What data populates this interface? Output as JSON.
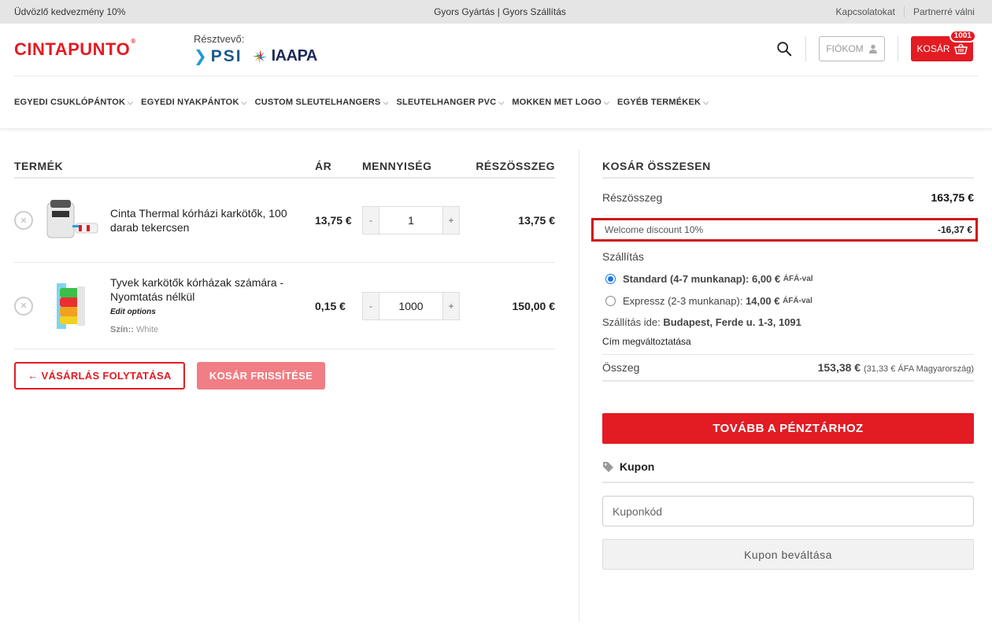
{
  "topbar": {
    "left": "Üdvözlő kedvezmény 10%",
    "center": "Gyors Gyártás | Gyors Szállítás",
    "links": [
      "Kapcsolatokat",
      "Partnerré válni"
    ]
  },
  "header": {
    "logo": "CINTAPUNTO",
    "logo_mark": "®",
    "partners_label": "Résztvevő:",
    "partner_psi": "PSI",
    "partner_iaapa": "IAAPA",
    "account_label": "FIÓKOM",
    "cart_label": "KOSÁR",
    "cart_count": "1001",
    "accent_color": "#e31b23"
  },
  "nav": [
    "EGYEDI CSUKLÓPÁNTOK",
    "EGYEDI NYAKPÁNTOK",
    "CUSTOM SLEUTELHANGERS",
    "SLEUTELHANGER PVC",
    "MOKKEN MET LOGO",
    "EGYÉB TERMÉKEK"
  ],
  "cart": {
    "headers": {
      "product": "TERMÉK",
      "price": "ÁR",
      "qty": "MENNYISÉG",
      "subtotal": "RÉSZÖSSZEG"
    },
    "items": [
      {
        "name": "Cinta Thermal kórházi karkötők, 100 darab tekercsen",
        "price": "13,75 €",
        "qty": "1",
        "subtotal": "13,75 €",
        "icon": "thermal-printer-icon"
      },
      {
        "name": "Tyvek karkötők kórházak számára - Nyomtatás nélkül",
        "edit": "Edit options",
        "color_label": "Szín:",
        "color_value": "White",
        "price": "0,15 €",
        "qty": "1000",
        "subtotal": "150,00 €",
        "icon": "wristband-rolls-icon"
      }
    ],
    "continue_label": "← VÁSÁRLÁS FOLYTATÁSA",
    "update_label": "KOSÁR FRISSÍTÉSE"
  },
  "totals": {
    "title": "KOSÁR ÖSSZESEN",
    "subtotal_label": "Részösszeg",
    "subtotal_value": "163,75 €",
    "discount_label": "Welcome discount 10%",
    "discount_value": "-16,37 €",
    "shipping_label": "Szállítás",
    "option_standard": "Standard (4-7 munkanap):",
    "option_standard_price": "6,00 €",
    "option_express": "Expressz (2-3 munkanap):",
    "option_express_price": "14,00 €",
    "vat_note": "ÁFÁ-val",
    "ship_to_label": "Szállítás ide:",
    "ship_to_value": "Budapest, Ferde u. 1-3, 1091",
    "change_address": "Cím megváltoztatása",
    "total_label": "Összeg",
    "total_value": "153,38 €",
    "total_tax": "(31,33 € ÁFA Magyarország)",
    "checkout_label": "TOVÁBB A PÉNZTÁRHOZ",
    "coupon_title": "Kupon",
    "coupon_placeholder": "Kuponkód",
    "coupon_button": "Kupon beváltása"
  }
}
